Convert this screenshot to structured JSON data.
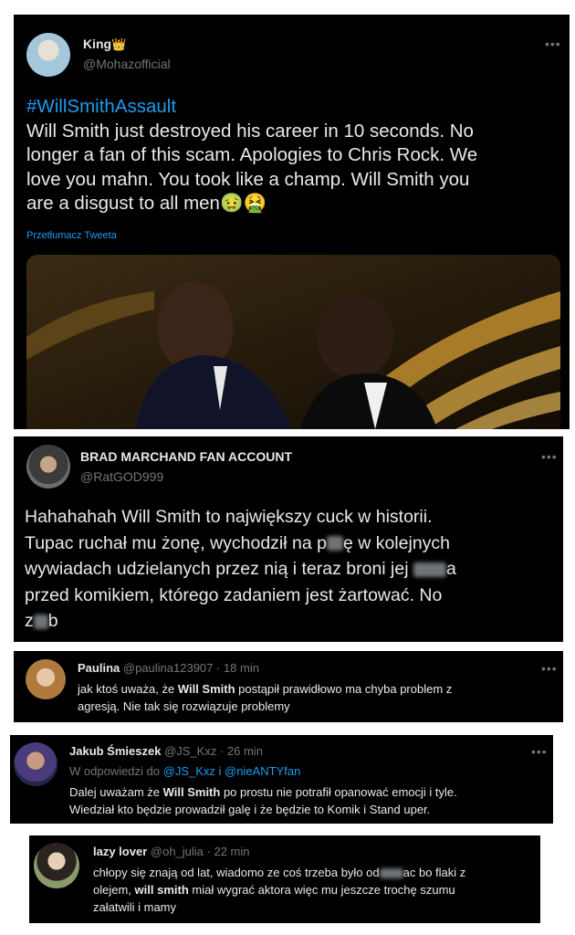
{
  "tweet1": {
    "name": "King",
    "handle": "@Mohazofficial",
    "hashtag": "#WillSmithAssault",
    "line1": "Will Smith just destroyed his career in 10 seconds. No",
    "line2": "longer a fan of this scam. Apologies to Chris Rock. We",
    "line3": "love you mahn. You took like a champ. Will Smith you",
    "line4": "are a disgust to all men",
    "translate": "Przetłumacz Tweeta",
    "emoji1": "🤢",
    "emoji2": "🤮",
    "crown": "👑"
  },
  "tweet2": {
    "name": "BRAD MARCHAND FAN ACCOUNT",
    "handle": "@RatGOD999",
    "l1": "Hahahahah Will Smith to największy cuck w historii.",
    "l2a": "Tupac ruchał mu żonę, wychodził na p",
    "l2b": "ę w kolejnych",
    "l3": "wywiadach udzielanych przez nią i teraz broni jej",
    "l3b": "a",
    "l4": "przed komikiem, którego zadaniem jest żartować. No",
    "l5a": "z",
    "l5b": "b"
  },
  "reply1": {
    "name": "Paulina",
    "meta": "@paulina123907 · 18 min",
    "l1a": "jak ktoś uważa, że ",
    "l1b": "Will Smith",
    "l1c": " postąpił prawidłowo ma chyba problem z",
    "l2": "agresją. Nie tak się rozwiązuje problemy"
  },
  "reply2": {
    "name": "Jakub Śmieszek",
    "meta": "@JS_Kxz · 26 min",
    "reply_prefix": "W odpowiedzi do ",
    "reply_to": "@JS_Kxz i @nieANTYfan",
    "l1a": "Dalej uważam że ",
    "l1b": "Will Smith",
    "l1c": " po prostu nie potrafił opanować emocji i tyle.",
    "l2": "Wiedział kto będzie prowadził galę i że będzie to Komik i Stand uper."
  },
  "reply3": {
    "name": "lazy lover",
    "meta": "@oh_julia · 22 min",
    "l1a": "chłopy się znają od lat, wiadomo ze coś trzeba było od",
    "l1b": "ac bo flaki z",
    "l2a": "olejem, ",
    "l2b": "will smith",
    "l2c": " miał wygrać aktora więc mu jeszcze trochę szumu",
    "l3": "załatwili i mamy"
  },
  "more_icon": "more-icon",
  "colors": {
    "bg": "#000000",
    "text": "#e7e9ea",
    "muted": "#71767b",
    "link": "#1d9bf0"
  }
}
